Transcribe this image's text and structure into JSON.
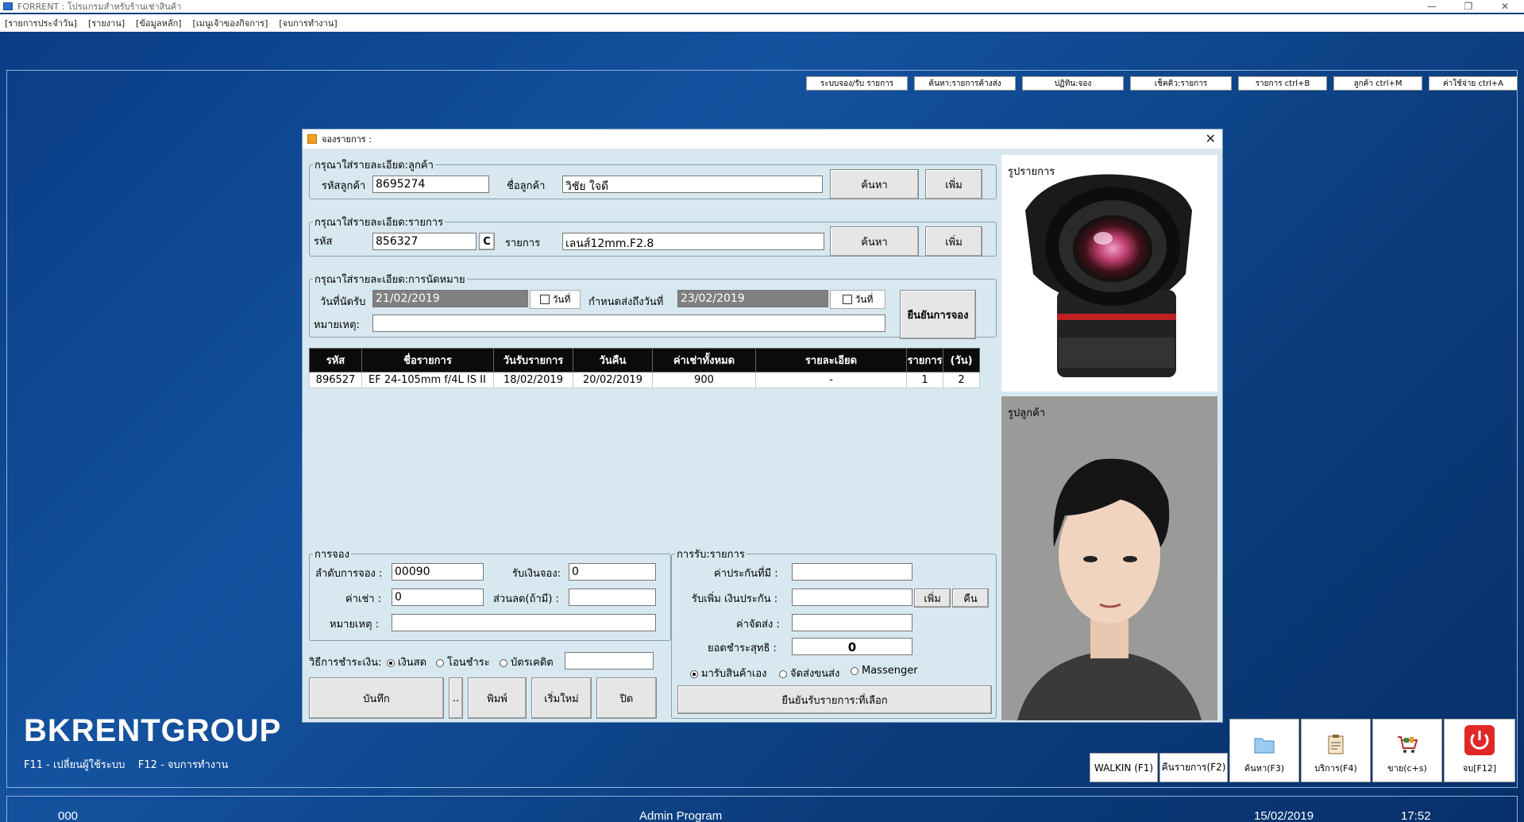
{
  "window": {
    "title": "FORRENT : โปรแกรมสำหรับร้านเช่าสินค้า"
  },
  "menu": [
    "[รายการประจำวัน]",
    "[รายงาน]",
    "[ข้อมูลหลัก]",
    "[เมนูเจ้าของกิจการ]",
    "[จบการทำงาน]"
  ],
  "top_buttons": [
    "ระบบจอง/รับ รายการ",
    "ค้นหา:รายการค้างส่ง",
    "ปฏิทิน:จอง",
    "เช็คคิว:รายการ",
    "รายการ ctrl+B",
    "ลูกค้า ctrl+M",
    "ค่าใช้จ่าย ctrl+A"
  ],
  "brand": {
    "name": "BKRENTGROUP",
    "keys": "F11 - เปลี่ยนผู้ใช้ระบบ    F12 - จบการทำงาน"
  },
  "status": {
    "code": "000",
    "program": "Admin Program",
    "date": "15/02/2019",
    "time": "17:52"
  },
  "tools": {
    "walkin": "WALKIN  (F1)",
    "return": "คืนรายการ(F2)",
    "search": "ค้นหา(F3)",
    "service": "บริการ(F4)",
    "sell": "ขาย(c+s)",
    "exit": "จบ[F12]"
  },
  "dialog": {
    "title": "จองรายการ :",
    "customer": {
      "legend": "กรุณาใส่รายละเอียด:ลูกค้า",
      "code_label": "รหัสลูกค้า",
      "code": "8695274",
      "name_label": "ชื่อลูกค้า",
      "name": "วิชัย ใจดี",
      "search": "ค้นหา",
      "add": "เพิ่ม"
    },
    "item": {
      "legend": "กรุณาใส่รายละเอียด:รายการ",
      "code_label": "รหัส",
      "code": "856327",
      "c_button": "C",
      "item_label": "รายการ",
      "item": "เลนส์12mm.F2.8",
      "search": "ค้นหา",
      "add": "เพิ่ม"
    },
    "appointment": {
      "legend": "กรุณาใส่รายละเอียด:การนัดหมาย",
      "pickup_label": "วันที่นัดรับ",
      "pickup": "21/02/2019",
      "date_btn": "วันที่",
      "due_label": "กำหนดส่งถึงวันที่",
      "due": "23/02/2019",
      "note_label": "หมายเหตุ:",
      "confirm": "ยืนยันการจอง"
    },
    "table": {
      "headers": [
        "รหัส",
        "ชื่อรายการ",
        "วันรับรายการ",
        "วันคืน",
        "ค่าเช่าทั้งหมด",
        "รายละเอียด",
        "รายการ",
        "(วัน)"
      ],
      "rows": [
        [
          "896527",
          "EF 24-105mm f/4L IS II",
          "18/02/2019",
          "20/02/2019",
          "900",
          "-",
          "1",
          "2"
        ]
      ]
    },
    "booking": {
      "legend": "การจอง",
      "seq_label": "ลำดับการจอง :",
      "seq": "00090",
      "deposit_label": "รับเงินจอง:",
      "deposit": "0",
      "rent_label": "ค่าเช่า :",
      "rent": "0",
      "discount_label": "ส่วนลด(ถ้ามี) :",
      "discount": "",
      "note_label": "หมายเหตุ :",
      "note": ""
    },
    "payment": {
      "label": "วิธีการชำระเงิน:",
      "options": [
        "เงินสด",
        "โอนชำระ",
        "บัตรเคดิต"
      ],
      "selected": "เงินสด"
    },
    "actions": {
      "save": "บันทึก",
      "dots": "..",
      "print": "พิมพ์",
      "new": "เริ่มใหม่",
      "close": "ปิด"
    },
    "receive": {
      "legend": "การรับ:รายการ",
      "insurance_label": "ค่าประกันที่มี :",
      "insurance": "",
      "extra_label": "รับเพิ่ม เงินประกัน :",
      "extra": "",
      "add": "เพิ่ม",
      "refund": "คืน",
      "delivery_label": "ค่าจัดส่ง :",
      "delivery": "",
      "net_label": "ยอดชำระสุทธิ :",
      "net": "0",
      "methods": [
        "มารับสินค้าเอง",
        "จัดส่งขนส่ง",
        "Massenger"
      ],
      "selected_method": "มารับสินค้าเอง",
      "confirm": "ยืนยันรับรายการ:ที่เลือก"
    },
    "item_image_caption": "รูปรายการ",
    "customer_image_caption": "รูปลูกค้า"
  }
}
